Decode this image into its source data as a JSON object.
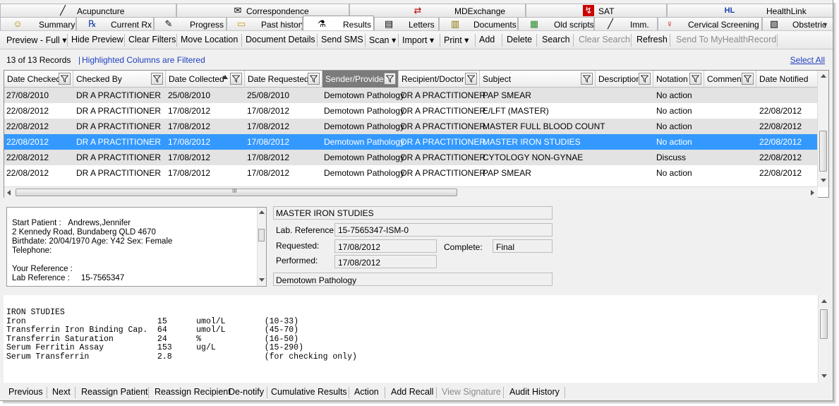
{
  "tabs_row1": [
    {
      "label": "Acupuncture",
      "icon": "needle-icon",
      "glyph": "╱"
    },
    {
      "label": "Correspondence",
      "icon": "envelope-icon",
      "glyph": "✉"
    },
    {
      "label": "MDExchange",
      "icon": "mdexchange-icon",
      "glyph": "⇄"
    },
    {
      "label": "SAT",
      "icon": "sat-icon",
      "glyph": "↯"
    },
    {
      "label": "HealthLink",
      "icon": "healthlink-icon",
      "glyph": "HL"
    }
  ],
  "tabs_row2": [
    {
      "label": "Summary",
      "icon": "smiley-icon",
      "glyph": "☺"
    },
    {
      "label": "Current Rx",
      "icon": "rx-icon",
      "glyph": "℞"
    },
    {
      "label": "Progress",
      "icon": "pencil-icon",
      "glyph": "✎"
    },
    {
      "label": "Past history",
      "icon": "folder-icon",
      "glyph": "▭"
    },
    {
      "label": "Results",
      "icon": "microscope-icon",
      "glyph": "⚗"
    },
    {
      "label": "Letters",
      "icon": "letter-icon",
      "glyph": "▤"
    },
    {
      "label": "Documents",
      "icon": "documents-icon",
      "glyph": "▥"
    },
    {
      "label": "Old scripts",
      "icon": "old-scripts-icon",
      "glyph": "▦"
    },
    {
      "label": "Imm.",
      "icon": "syringe-icon",
      "glyph": "╱"
    },
    {
      "label": "Cervical Screening",
      "icon": "cervical-icon",
      "glyph": "♀"
    },
    {
      "label": "Obstetric",
      "icon": "obstetric-icon",
      "glyph": "▧"
    }
  ],
  "toolbar": {
    "items": [
      {
        "label": "Preview - Full",
        "dropdown": true,
        "disabled": false
      },
      {
        "label": "Hide Preview",
        "dropdown": false,
        "disabled": false
      },
      {
        "label": "Clear Filters",
        "dropdown": false,
        "disabled": false
      },
      {
        "label": "Move Location",
        "dropdown": false,
        "disabled": false
      },
      {
        "label": "Document Details",
        "dropdown": false,
        "disabled": false
      },
      {
        "label": "Send SMS",
        "dropdown": false,
        "disabled": false
      },
      {
        "label": "Scan",
        "dropdown": true,
        "disabled": false
      },
      {
        "label": "Import",
        "dropdown": true,
        "disabled": false
      },
      {
        "label": "Print",
        "dropdown": true,
        "disabled": false
      },
      {
        "label": "Add",
        "dropdown": false,
        "disabled": false
      },
      {
        "label": "Delete",
        "dropdown": false,
        "disabled": false
      },
      {
        "label": "Search",
        "dropdown": false,
        "disabled": false
      },
      {
        "label": "Clear Search",
        "dropdown": false,
        "disabled": true
      },
      {
        "label": "Refresh",
        "dropdown": false,
        "disabled": false
      },
      {
        "label": "Send To MyHealthRecord",
        "dropdown": false,
        "disabled": true
      }
    ]
  },
  "status": {
    "records": "13 of 13 Records",
    "filtered_note": "Highlighted Columns are Filtered",
    "select_all": "Select All"
  },
  "grid": {
    "columns": [
      "Date Checked",
      "Checked By",
      "Date Collected",
      "Date Requested",
      "Sender/Provider",
      "Recipient/Doctor",
      "Subject",
      "Description",
      "Notation",
      "Comment",
      "Date Notified"
    ],
    "rows": [
      [
        "27/08/2010",
        "DR A PRACTITIONER",
        "25/08/2010",
        "25/08/2010",
        "Demotown Pathology",
        "DR A PRACTITIONER",
        "PAP SMEAR",
        "",
        "No action",
        "",
        ""
      ],
      [
        "22/08/2012",
        "DR A PRACTITIONER",
        "17/08/2012",
        "17/08/2012",
        "Demotown Pathology",
        "DR A PRACTITIONER",
        "E/LFT (MASTER)",
        "",
        "No action",
        "",
        "22/08/2012"
      ],
      [
        "22/08/2012",
        "DR A PRACTITIONER",
        "17/08/2012",
        "17/08/2012",
        "Demotown Pathology",
        "DR A PRACTITIONER",
        "MASTER FULL BLOOD COUNT",
        "",
        "No action",
        "",
        "22/08/2012"
      ],
      [
        "22/08/2012",
        "DR A PRACTITIONER",
        "17/08/2012",
        "17/08/2012",
        "Demotown Pathology",
        "DR A PRACTITIONER",
        "MASTER IRON STUDIES",
        "",
        "No action",
        "",
        "22/08/2012"
      ],
      [
        "22/08/2012",
        "DR A PRACTITIONER",
        "17/08/2012",
        "17/08/2012",
        "Demotown Pathology",
        "DR A PRACTITIONER",
        "CYTOLOGY NON-GYNAE",
        "",
        "Discuss",
        "",
        "22/08/2012"
      ],
      [
        "22/08/2012",
        "DR A PRACTITIONER",
        "17/08/2012",
        "17/08/2012",
        "Demotown Pathology",
        "DR A PRACTITIONER",
        "PAP SMEAR",
        "",
        "No action",
        "",
        "22/08/2012"
      ]
    ],
    "hscroll_grip": "III"
  },
  "patient": {
    "start_label": "Start Patient  :",
    "name": "Andrews,Jennifer",
    "address": "2 Kennedy Road, Bundaberg QLD 4670",
    "birthdate_line": "Birthdate: 20/04/1970    Age: Y42    Sex: Female",
    "telephone_label": "Telephone:",
    "your_ref_label": "Your Reference :",
    "lab_ref_label": "Lab Reference   :",
    "lab_ref_value": "15-7565347"
  },
  "result": {
    "title": "MASTER IRON STUDIES",
    "lab_ref_label": "Lab. Reference:",
    "lab_ref_value": "15-7565347-ISM-0",
    "requested_label": "Requested:",
    "requested_value": "17/08/2012",
    "complete_label": "Complete:",
    "complete_value": "Final",
    "performed_label": "Performed:",
    "performed_value": "17/08/2012",
    "provider": "Demotown Pathology"
  },
  "report_lines": [
    "IRON STUDIES",
    "Iron                           15      umol/L        (10-33)",
    "Transferrin Iron Binding Cap.  64      umol/L        (45-70)",
    "Transferrin Saturation         24      %             (16-50)",
    "Serum Ferritin Assay           153     ug/L          (15-290)",
    "Serum Transferrin              2.8                   (for checking only)"
  ],
  "bottom_actions": [
    {
      "label": "Previous",
      "disabled": false
    },
    {
      "label": "Next",
      "disabled": false
    },
    {
      "label": "Reassign Patient",
      "disabled": false
    },
    {
      "label": "Reassign Recipient",
      "disabled": false
    },
    {
      "label": "De-notify",
      "disabled": false
    },
    {
      "label": "Cumulative Results",
      "disabled": false
    },
    {
      "label": "Action",
      "disabled": false
    },
    {
      "label": "Add Recall",
      "disabled": false
    },
    {
      "label": "View Signature",
      "disabled": true
    },
    {
      "label": "Audit History",
      "disabled": false
    }
  ],
  "colors": {
    "selected_row": "#3399ff",
    "alt_row": "#e3e3e3",
    "link": "#1f3fc0",
    "filtered_header": "#7b7b7b"
  }
}
